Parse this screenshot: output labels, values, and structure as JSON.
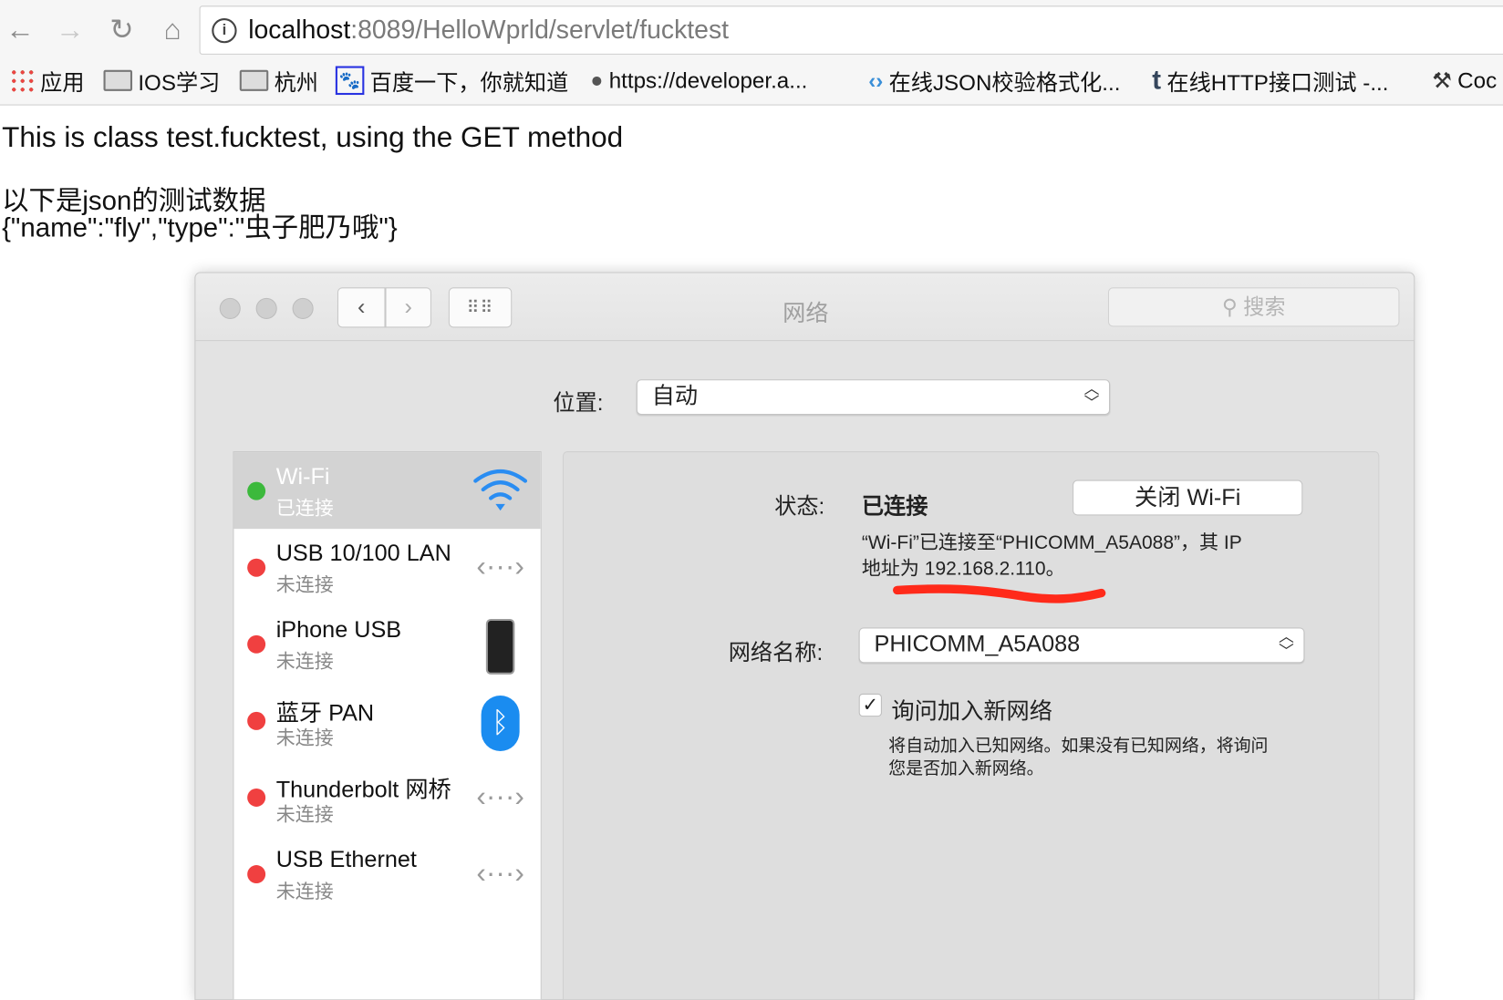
{
  "browser": {
    "url_host": "localhost",
    "url_rest": ":8089/HelloWprld/servlet/fucktest",
    "bookmarks": [
      {
        "label": "应用",
        "icon": "apps-grid-icon"
      },
      {
        "label": "IOS学习",
        "icon": "folder-icon"
      },
      {
        "label": "杭州",
        "icon": "folder-icon"
      },
      {
        "label": "百度一下，你就知道",
        "icon": "baidu-paw-icon"
      },
      {
        "label": "https://developer.a...",
        "icon": "apple-icon"
      },
      {
        "label": "在线JSON校验格式化...",
        "icon": "json-icon"
      },
      {
        "label": "在线HTTP接口测试 -...",
        "icon": "tumblr-icon"
      },
      {
        "label": "Coc",
        "icon": "hammer-icon"
      }
    ]
  },
  "page": {
    "line1": "This is class test.fucktest, using the GET method",
    "line2": "以下是json的测试数据",
    "line3": "{\"name\":\"fly\",\"type\":\"虫子肥乃哦\"}"
  },
  "dialog": {
    "title": "网络",
    "search_placeholder": "搜索",
    "location_label": "位置:",
    "location_value": "自动",
    "services": [
      {
        "name": "Wi-Fi",
        "status": "已连接",
        "color": "#3cb93c",
        "icon": "wifi-icon",
        "selected": true
      },
      {
        "name": "USB 10/100 LAN",
        "status": "未连接",
        "color": "#f04040",
        "icon": "ethernet-arrows-icon"
      },
      {
        "name": "iPhone USB",
        "status": "未连接",
        "color": "#f04040",
        "icon": "iphone-icon"
      },
      {
        "name": "蓝牙 PAN",
        "status": "未连接",
        "color": "#f04040",
        "icon": "bluetooth-icon"
      },
      {
        "name": "Thunderbolt 网桥",
        "status": "未连接",
        "color": "#f04040",
        "icon": "ethernet-arrows-icon"
      },
      {
        "name": "USB Ethernet",
        "status": "未连接",
        "color": "#f04040",
        "icon": "ethernet-arrows-icon"
      }
    ],
    "status_label": "状态:",
    "status_value": "已连接",
    "turn_off_button": "关闭 Wi-Fi",
    "status_desc_1": "“Wi-Fi”已连接至“PHICOMM_A5A088”，其 IP",
    "status_desc_2": "地址为 192.168.2.110。",
    "network_name_label": "网络名称:",
    "network_name_value": "PHICOMM_A5A088",
    "ask_join_label": "询问加入新网络",
    "ask_join_checked": true,
    "ask_join_help_1": "将自动加入已知网络。如果没有已知网络，将询问",
    "ask_join_help_2": "您是否加入新网络。",
    "annotation_color": "#ff2a1a"
  }
}
